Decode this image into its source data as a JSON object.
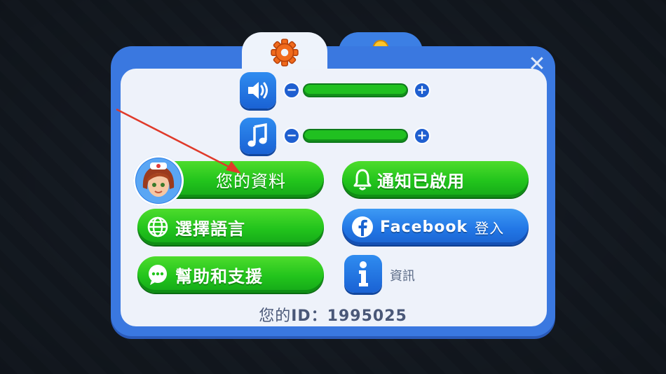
{
  "tabs": [
    {
      "icon": "gear-icon",
      "active": true
    },
    {
      "icon": "bell-icon",
      "active": false
    }
  ],
  "audio": {
    "sound": {
      "icon": "speaker-icon",
      "level": 1.0
    },
    "music": {
      "icon": "music-note-icon",
      "level": 1.0
    },
    "minus": "−",
    "plus": "+"
  },
  "buttons": {
    "profile": "您的資料",
    "notifications": "通知已啟用",
    "language": "選擇語言",
    "facebook_brand": "Facebook",
    "facebook_action": "登入",
    "help": "幫助和支援"
  },
  "info_label": "資訊",
  "user": {
    "id_prefix": "您的",
    "id_label": "ID：",
    "id_value": "1995025"
  },
  "close": "✕",
  "colors": {
    "panel": "#3a78e0",
    "green": "#22c41c",
    "blue": "#2277e6"
  }
}
